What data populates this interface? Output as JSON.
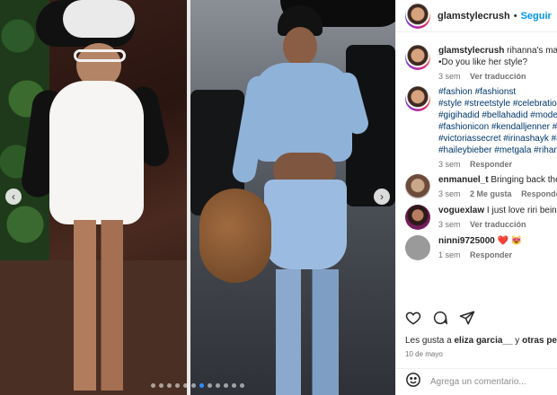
{
  "post": {
    "username": "glamstylecrush",
    "separator": "•",
    "follow_label": "Seguir"
  },
  "carousel": {
    "slide_count": 12,
    "active_slide": 6,
    "prev_icon": "chevron-left-icon",
    "next_icon": "chevron-right-icon"
  },
  "comments": [
    {
      "user": "glamstylecrush",
      "text": " rihanna's mater",
      "line2": "•Do you like her style?",
      "meta": [
        "3 sem",
        "Ver traducción"
      ]
    },
    {
      "user": "glamstylecrush",
      "hashtags": [
        "#fashion #fashionst",
        "#style #streetstyle #celebration",
        "#gigihadid #bellahadid #model",
        "#fashionicon #kendalljenner #ky",
        "#victoriassecret #irinashayk #ad",
        "#haileybieber #metgala #rihann"
      ],
      "meta": [
        "3 sem",
        "Responder"
      ]
    },
    {
      "user": "enmanuel_t",
      "text": " Bringing back the h",
      "meta": [
        "3 sem",
        "2 Me gusta",
        "Responder"
      ]
    },
    {
      "user": "voguexlaw",
      "text": " I just love riri being p",
      "meta": [
        "3 sem",
        "Ver traducción"
      ]
    },
    {
      "user": "ninni9725000",
      "text": " ❤️ 😻",
      "meta": [
        "1 sem",
        "Responder"
      ]
    }
  ],
  "actions": {
    "like_icon": "heart-icon",
    "comment_icon": "comment-icon",
    "share_icon": "send-icon"
  },
  "likes": {
    "prefix": "Les gusta a ",
    "user": "eliza garcia__",
    "suffix": " y ",
    "others": "otras person"
  },
  "date": "10 de mayo",
  "add_comment": {
    "emoji_icon": "smiley-icon",
    "placeholder": "Agrega un comentario..."
  },
  "colors": {
    "link_blue": "#0095f6",
    "hashtag_blue": "#00376b",
    "muted": "#737373",
    "active_dot": "#2f8cff"
  }
}
